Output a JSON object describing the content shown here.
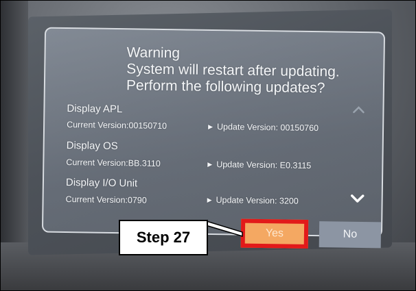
{
  "dialog": {
    "title": "Warning",
    "message_line1": "System will restart after updating.",
    "message_line2": "Perform the following updates?",
    "items": [
      {
        "name": "Display APL",
        "current": "Current Version:00150710",
        "update": "Update Version: 00150760"
      },
      {
        "name": "Display OS",
        "current": "Current Version:BB.3110",
        "update": "Update Version: E0.3115"
      },
      {
        "name": "Display I/O Unit",
        "current": "Current Version:0790",
        "update": "Update Version: 3200"
      }
    ],
    "yes_label": "Yes",
    "no_label": "No"
  },
  "callout": {
    "label": "Step 27"
  },
  "icons": {
    "scroll_up": "chevron-up-icon",
    "scroll_down": "chevron-down-icon",
    "bullet": "play-arrow-icon"
  },
  "colors": {
    "highlight_border": "#e21a1a",
    "yes_button": "#f4a862",
    "no_button": "#8c95a3"
  }
}
